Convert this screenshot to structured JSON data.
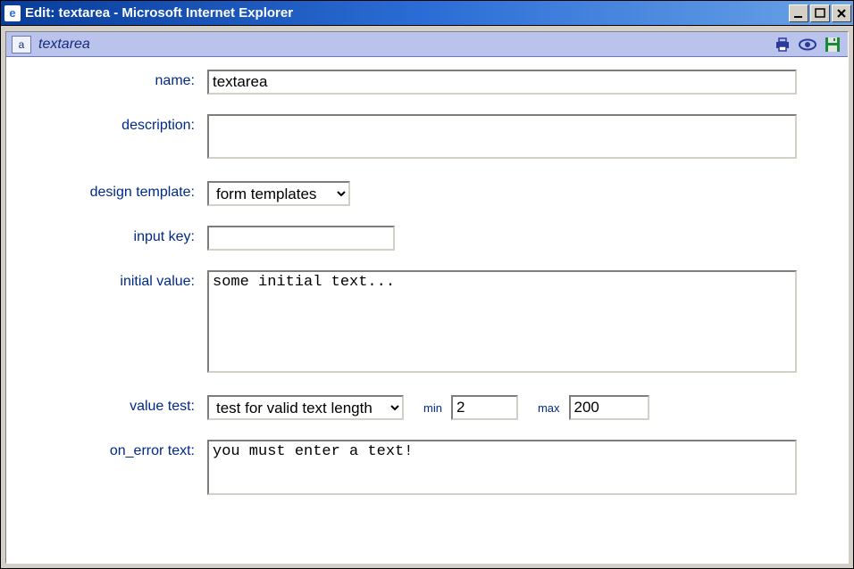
{
  "window": {
    "title": "Edit: textarea - Microsoft Internet Explorer"
  },
  "toolbar": {
    "form_title": "textarea",
    "field_icon_glyph": "a",
    "icons": {
      "print": "print-icon",
      "preview": "eye-icon",
      "save": "disk-icon"
    }
  },
  "labels": {
    "name": "name:",
    "description": "description:",
    "design_template": "design template:",
    "input_key": "input key:",
    "initial_value": "initial value:",
    "value_test": "value test:",
    "min": "min",
    "max": "max",
    "on_error_text": "on_error text:"
  },
  "fields": {
    "name": "textarea",
    "description": "",
    "design_template": "form templates",
    "input_key": "",
    "initial_value": "some initial text...",
    "value_test": "test for valid text length",
    "min": "2",
    "max": "200",
    "on_error_text": "you must enter a text!"
  }
}
